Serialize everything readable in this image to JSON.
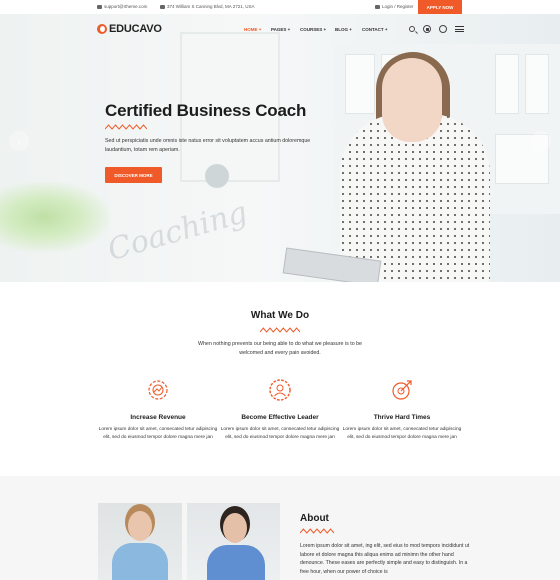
{
  "topbar": {
    "email": "support@rtheme.com",
    "address": "374 William S Canning Blvd, MA 2721, USA",
    "login": "Login / Register",
    "apply": "APPLY NOW"
  },
  "header": {
    "logo": "EDUCAVO",
    "nav": [
      {
        "label": "HOME",
        "active": true
      },
      {
        "label": "PAGES",
        "active": false
      },
      {
        "label": "COURSES",
        "active": false
      },
      {
        "label": "BLOG",
        "active": false
      },
      {
        "label": "CONTACT",
        "active": false
      }
    ]
  },
  "hero": {
    "title": "Certified Business Coach",
    "text": "Sed ut perspiciatis unde omnis iste natus error sit voluptatem accus antium doloremque laudantium, totam rem aperiam.",
    "button": "DISCOVER MORE",
    "watermark": "Coaching",
    "prev": "‹",
    "next": "›"
  },
  "services": {
    "title": "What We Do",
    "subtitle": "When nothing prevents our being able to do what we pleasure is to be welcomed and every pain avoided.",
    "items": [
      {
        "icon": "revenue-gear-icon",
        "title": "Increase Revenue",
        "text": "Lorem ipsum dolor sit amet, consecated tetur adipiscing elit, sed do eiusmod tempor dolore magna mere jan"
      },
      {
        "icon": "leader-gear-icon",
        "title": "Become Effective Leader",
        "text": "Lorem ipsum dolor sit amet, consecated tetur adipiscing elit, sed do eiusmod tempor dolore magna mere jan"
      },
      {
        "icon": "strive-arrow-icon",
        "title": "Thrive Hard Times",
        "text": "Lorem ipsum dolor sit amet, consecated tetur adipiscing elit, sed do eiusmod tempor dolore magna mere jan"
      }
    ]
  },
  "about": {
    "title": "About",
    "text": "Lorem ipsum dolor sit amet, ing elit, sed eius to mod tempors incididunt ut labore et dolore magna this aliqua enims ad minimn the other hand denounce. These eases are perfectly simple and easy to distinguish. In a free hour, when our power of choice is"
  },
  "colors": {
    "accent": "#f05a28",
    "text": "#1d1d1d"
  }
}
